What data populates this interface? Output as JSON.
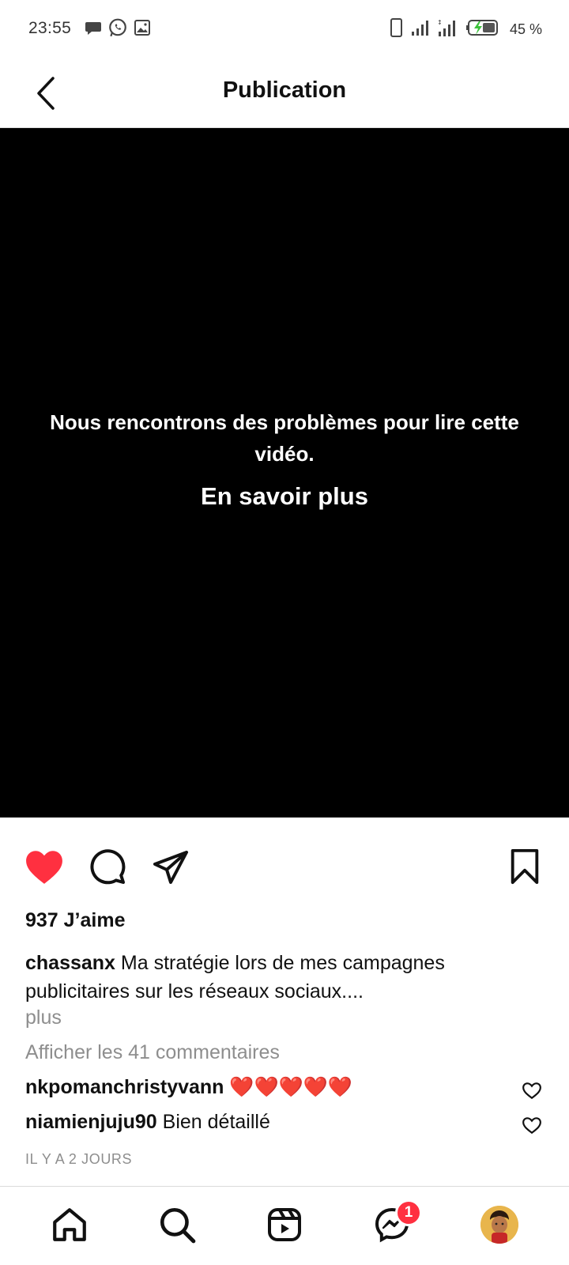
{
  "status_bar": {
    "time": "23:55",
    "battery": "45 %",
    "left_icons": [
      "message-icon",
      "whatsapp-icon",
      "gallery-icon"
    ],
    "right_icons": [
      "phone-icon",
      "signal-icon",
      "signal-icon",
      "battery-icon"
    ]
  },
  "header": {
    "title": "Publication"
  },
  "video": {
    "error_message": "Nous rencontrons des problèmes pour lire cette vidéo.",
    "learn_more": "En savoir plus"
  },
  "post": {
    "liked": true,
    "likes": "937 J’aime",
    "author": "chassanx",
    "caption": "Ma stratégie lors de mes campagnes publicitaires sur les réseaux sociaux....",
    "more": "plus",
    "view_comments": "Afficher les 41 commentaires",
    "comments": [
      {
        "user": "nkpomanchristyvann",
        "text": "❤️❤️❤️❤️❤️"
      },
      {
        "user": "niamienjuju90",
        "text": "Bien détaillé"
      }
    ],
    "timestamp": "IL Y A 2 JOURS"
  },
  "bottom_nav": {
    "items": [
      "home-icon",
      "search-icon",
      "reels-icon",
      "messenger-icon",
      "profile-avatar"
    ],
    "messenger_badge": "1"
  },
  "colors": {
    "like_red": "#ff3040",
    "secondary_text": "#8e8e8e",
    "divider": "#dbdbdb"
  }
}
